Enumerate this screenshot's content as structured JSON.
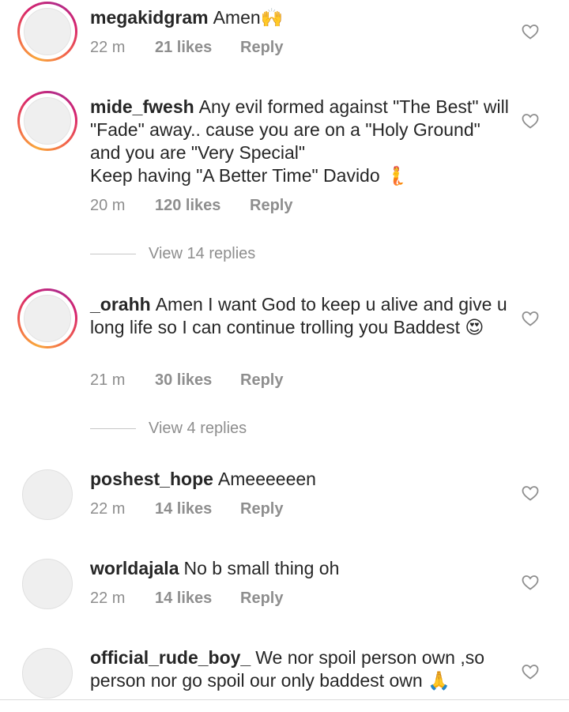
{
  "comments": [
    {
      "username": "megakidgram",
      "text": "Amen",
      "emoji": "🙌",
      "time": "22 m",
      "likes": "21 likes",
      "reply": "Reply",
      "story_ring": true
    },
    {
      "username": "mide_fwesh",
      "line1": "Any evil formed against \"The Best\" will \"Fade\" away.. cause you are on a \"Holy Ground\" and you are \"Very Special\"",
      "line2": "Keep having \"A Better Time\" Davido",
      "emoji": "🧜",
      "time": "20 m",
      "likes": "120 likes",
      "reply": "Reply",
      "story_ring": true,
      "view_replies": "View 14 replies"
    },
    {
      "username": "_orahh",
      "text": "Amen I want God to keep u alive and give u long life so I can continue trolling you Baddest",
      "emoji": "😍",
      "time": "21 m",
      "likes": "30 likes",
      "reply": "Reply",
      "story_ring": true,
      "view_replies": "View 4 replies"
    },
    {
      "username": "poshest_hope",
      "text": "Ameeeeeen",
      "time": "22 m",
      "likes": "14 likes",
      "reply": "Reply",
      "story_ring": false
    },
    {
      "username": "worldajala",
      "text": "No b small thing oh",
      "time": "22 m",
      "likes": "14 likes",
      "reply": "Reply",
      "story_ring": false
    },
    {
      "username": "official_rude_boy_",
      "text": "We nor spoil person own ,so person nor go spoil our only baddest own",
      "emoji": "🙏",
      "story_ring": false
    }
  ],
  "icons": {
    "like": "heart-outline-icon"
  },
  "colors": {
    "text": "#262626",
    "meta": "#8e8e8e",
    "story_gradient_start": "#f9a83b",
    "story_gradient_end": "#d6246e"
  }
}
